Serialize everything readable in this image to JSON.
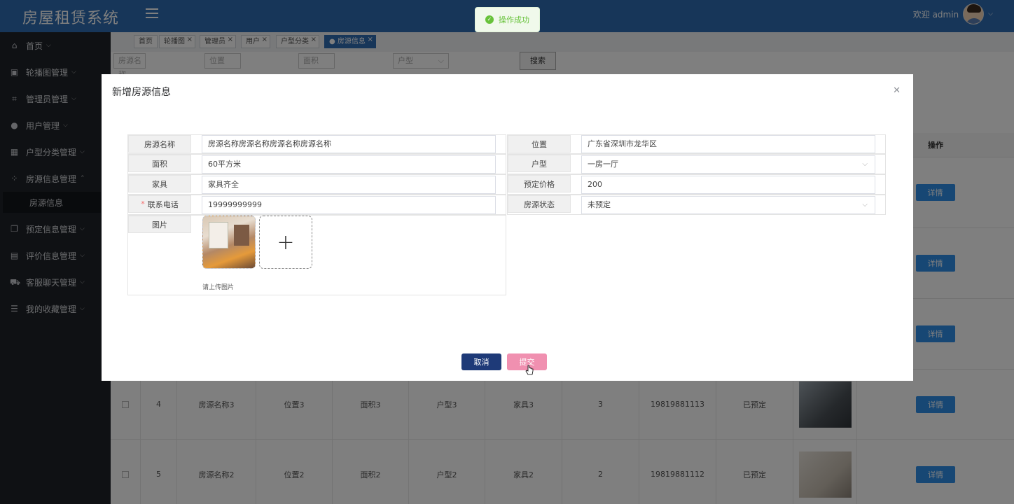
{
  "header": {
    "title": "房屋租赁系统",
    "welcome": "欢迎 admin"
  },
  "toast": {
    "message": "操作成功"
  },
  "sidebar": {
    "items": [
      {
        "label": "首页",
        "icon": "home-icon"
      },
      {
        "label": "轮播图管理",
        "icon": "image-icon"
      },
      {
        "label": "管理员管理",
        "icon": "crop-icon"
      },
      {
        "label": "用户管理",
        "icon": "user-icon"
      },
      {
        "label": "户型分类管理",
        "icon": "grid-icon"
      },
      {
        "label": "房源信息管理",
        "icon": "apps-icon",
        "expanded": true
      },
      {
        "label": "预定信息管理",
        "icon": "copy-icon"
      },
      {
        "label": "评价信息管理",
        "icon": "list-icon"
      },
      {
        "label": "客服聊天管理",
        "icon": "car-icon"
      },
      {
        "label": "我的收藏管理",
        "icon": "server-icon"
      }
    ],
    "sub_item": "房源信息"
  },
  "tabs": [
    {
      "label": "首页",
      "closable": false
    },
    {
      "label": "轮播图",
      "closable": true
    },
    {
      "label": "管理员",
      "closable": true
    },
    {
      "label": "用户",
      "closable": true
    },
    {
      "label": "户型分类",
      "closable": true
    },
    {
      "label": "房源信息",
      "closable": true,
      "active": true
    }
  ],
  "search": {
    "name_placeholder": "房源名称",
    "location_placeholder": "位置",
    "area_placeholder": "面积",
    "type_placeholder": "户型",
    "search_label": "搜索"
  },
  "table": {
    "op_header": "操作",
    "detail_label": "详情",
    "rows": [
      {
        "index": "4",
        "name": "房源名称3",
        "location": "位置3",
        "area": "面积3",
        "type": "户型3",
        "furniture": "家具3",
        "price": "3",
        "phone": "19819881113",
        "status": "已预定"
      },
      {
        "index": "5",
        "name": "房源名称2",
        "location": "位置2",
        "area": "面积2",
        "type": "户型2",
        "furniture": "家具2",
        "price": "2",
        "phone": "19819881112",
        "status": "已预定"
      }
    ]
  },
  "dialog": {
    "title": "新增房源信息",
    "fields": {
      "name": {
        "label": "房源名称",
        "value": "房源名称房源名称房源名称房源名称"
      },
      "location": {
        "label": "位置",
        "value": "广东省深圳市龙华区"
      },
      "area": {
        "label": "面积",
        "value": "60平方米"
      },
      "type": {
        "label": "户型",
        "value": "一房一厅"
      },
      "furniture": {
        "label": "家具",
        "value": "家具齐全"
      },
      "price": {
        "label": "预定价格",
        "value": "200"
      },
      "phone": {
        "label": "联系电话",
        "value": "19999999999",
        "required": "*"
      },
      "status": {
        "label": "房源状态",
        "value": "未预定"
      },
      "image": {
        "label": "图片",
        "tip": "请上传图片"
      }
    },
    "cancel_label": "取消",
    "submit_label": "提交"
  }
}
